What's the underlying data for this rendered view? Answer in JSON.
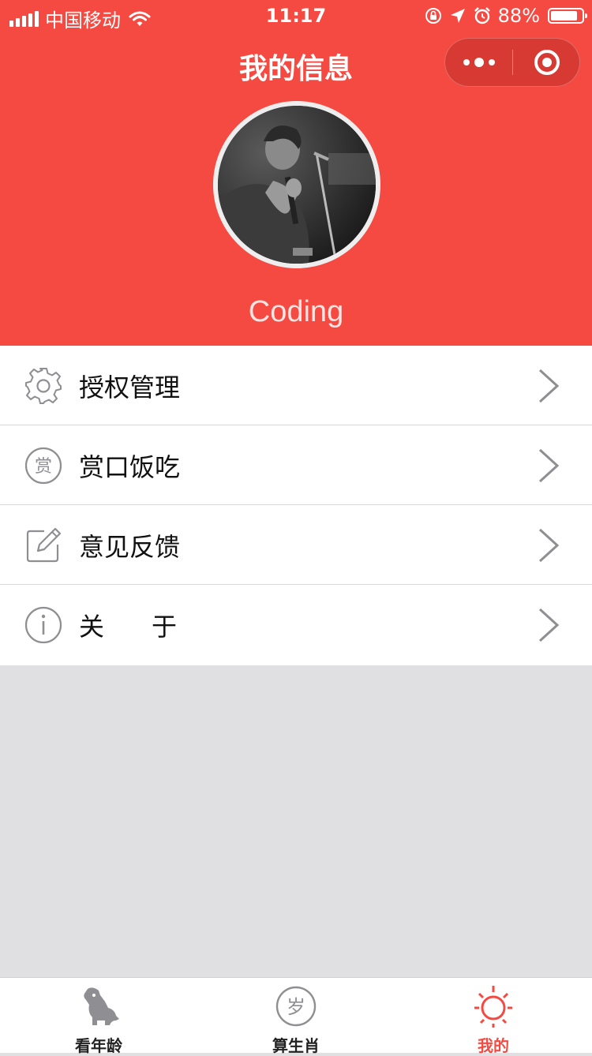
{
  "status_bar": {
    "carrier": "中国移动",
    "time": "11:17",
    "battery": "88%",
    "battery_level": 0.88
  },
  "nav": {
    "title": "我的信息",
    "more_icon": "more-dots-icon",
    "close_icon": "target-circle-icon"
  },
  "profile": {
    "avatar": "avatar-photo",
    "username": "Coding"
  },
  "menu": [
    {
      "label": "授权管理",
      "icon": "gear-icon"
    },
    {
      "label": "赏口饭吃",
      "icon": "reward-icon",
      "icon_text": "赏"
    },
    {
      "label": "意见反馈",
      "icon": "edit-icon"
    },
    {
      "label": "关于",
      "icon": "info-icon"
    }
  ],
  "tabbar": {
    "items": [
      {
        "label": "看年龄",
        "icon": "dog-icon",
        "active": false
      },
      {
        "label": "算生肖",
        "icon": "age-icon",
        "icon_text": "岁",
        "active": false
      },
      {
        "label": "我的",
        "icon": "sun-icon",
        "active": true
      }
    ]
  },
  "colors": {
    "brand": "#f44a41",
    "background": "#e0dfe2",
    "icon_gray": "#8e8e93"
  }
}
